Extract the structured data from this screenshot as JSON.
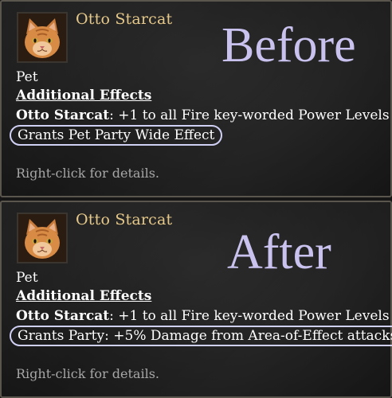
{
  "tooltips": [
    {
      "overlay_label": "Before",
      "item_name": "Otto Starcat",
      "item_type": "Pet",
      "section_heading": "Additional Effects",
      "effect_name": "Otto Starcat",
      "effect_text": ": +1 to all Fire key-worded Power Levels",
      "highlighted_text": "Grants Pet Party Wide Effect",
      "hint": "Right-click for details.",
      "icon": "orange-cat-portrait"
    },
    {
      "overlay_label": "After",
      "item_name": "Otto Starcat",
      "item_type": "Pet",
      "section_heading": "Additional Effects",
      "effect_name": "Otto Starcat",
      "effect_text": ": +1 to all Fire key-worded Power Levels",
      "highlighted_text": "Grants Party: +5% Damage from Area-of-Effect attacks",
      "hint": "Right-click for details.",
      "icon": "orange-cat-portrait"
    }
  ],
  "colors": {
    "item_name": "#e6c98a",
    "overlay_label": "#c9c2ef",
    "highlight_border": "#cfd0f4",
    "hint": "#a7a7a7",
    "panel_border": "#5a554d"
  }
}
